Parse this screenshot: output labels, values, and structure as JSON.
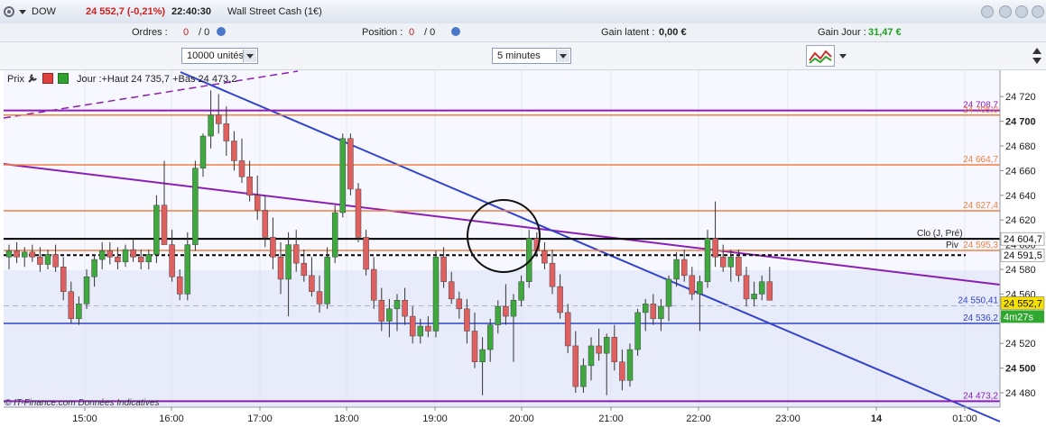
{
  "header": {
    "symbol": "DOW",
    "price": "24 552,7 (-0,21%)",
    "time": "22:40:30",
    "instrument": "Wall Street Cash (1€)"
  },
  "toolbar": {
    "orders_label": "Ordres :",
    "orders_value": "0",
    "orders_sep": "/ 0",
    "position_label": "Position :",
    "position_value": "0",
    "position_sep": "/ 0",
    "latent_label": "Gain latent :",
    "latent_value": "0,00 €",
    "day_label": "Gain Jour :",
    "day_value": "31,47 €"
  },
  "controls": {
    "units": "10000 unités",
    "period": "5 minutes"
  },
  "legend": {
    "prix": "Prix",
    "jour": "Jour :+Haut 24 735,7 +Bas 24 473,2"
  },
  "footer": "© IT-Finance.com  Données Indicatives",
  "colors": {
    "up": "#3fa83f",
    "down": "#e06060",
    "orange": "#f08040",
    "purple": "#8a1fb5",
    "blue": "#3344cc",
    "bg": "#eef0fb"
  },
  "chart_data": {
    "type": "candlestick",
    "y_axis": {
      "min": 24470,
      "max": 24730,
      "ticks": [
        24480,
        24500,
        24520,
        24540,
        24560,
        24580,
        24600,
        24620,
        24640,
        24660,
        24680,
        24700,
        24720
      ]
    },
    "x_ticks": [
      "15:00",
      "16:00",
      "17:00",
      "18:00",
      "19:00",
      "20:00",
      "21:00",
      "22:00",
      "23:00",
      "14",
      "01:00"
    ],
    "levels": [
      {
        "value": 24708.7,
        "label": "24 708,7",
        "color": "#8a1fb5"
      },
      {
        "value": 24705.0,
        "label": "24 705,0",
        "color": "#f08040"
      },
      {
        "value": 24664.7,
        "label": "24 664,7",
        "color": "#f08040"
      },
      {
        "value": 24627.4,
        "label": "24 627,4",
        "color": "#f08040"
      },
      {
        "value": 24604.7,
        "label": "24 604,7",
        "color": "#000000",
        "note": "Clo (J, Pré)"
      },
      {
        "value": 24595.3,
        "label": "24 595,3",
        "color": "#f08040",
        "note": "Piv"
      },
      {
        "value": 24591.5,
        "label": "24 591,5",
        "color": "#000000",
        "dashed": true
      },
      {
        "value": 24550.4,
        "label": "24 550,41",
        "color": "#3344cc"
      },
      {
        "value": 24536.2,
        "label": "24 536,2",
        "color": "#3344cc"
      },
      {
        "value": 24473.2,
        "label": "24 473,2",
        "color": "#8a1fb5"
      }
    ],
    "current": {
      "value": 24552.7,
      "label": "24 552,7",
      "countdown": "4m27s"
    },
    "candles": [
      [
        24590,
        24600,
        24580,
        24595
      ],
      [
        24595,
        24602,
        24585,
        24590
      ],
      [
        24590,
        24598,
        24582,
        24594
      ],
      [
        24594,
        24600,
        24586,
        24590
      ],
      [
        24590,
        24598,
        24578,
        24584
      ],
      [
        24584,
        24596,
        24580,
        24592
      ],
      [
        24592,
        24600,
        24578,
        24582
      ],
      [
        24582,
        24590,
        24555,
        24562
      ],
      [
        24562,
        24570,
        24536,
        24540
      ],
      [
        24540,
        24558,
        24535,
        24552
      ],
      [
        24552,
        24580,
        24548,
        24574
      ],
      [
        24574,
        24592,
        24566,
        24588
      ],
      [
        24588,
        24602,
        24580,
        24595
      ],
      [
        24595,
        24602,
        24584,
        24590
      ],
      [
        24590,
        24598,
        24580,
        24586
      ],
      [
        24586,
        24600,
        24582,
        24596
      ],
      [
        24596,
        24604,
        24586,
        24590
      ],
      [
        24590,
        24596,
        24580,
        24586
      ],
      [
        24586,
        24596,
        24580,
        24592
      ],
      [
        24592,
        24640,
        24585,
        24632
      ],
      [
        24632,
        24668,
        24625,
        24600
      ],
      [
        24600,
        24612,
        24570,
        24574
      ],
      [
        24574,
        24580,
        24555,
        24560
      ],
      [
        24560,
        24610,
        24555,
        24600
      ],
      [
        24600,
        24668,
        24595,
        24662
      ],
      [
        24662,
        24690,
        24655,
        24688
      ],
      [
        24688,
        24725,
        24678,
        24705
      ],
      [
        24705,
        24722,
        24690,
        24698
      ],
      [
        24698,
        24712,
        24672,
        24684
      ],
      [
        24684,
        24692,
        24660,
        24668
      ],
      [
        24668,
        24686,
        24650,
        24655
      ],
      [
        24655,
        24668,
        24635,
        24640
      ],
      [
        24640,
        24656,
        24620,
        24628
      ],
      [
        24628,
        24640,
        24598,
        24606
      ],
      [
        24606,
        24622,
        24580,
        24590
      ],
      [
        24590,
        24602,
        24560,
        24572
      ],
      [
        24572,
        24610,
        24542,
        24600
      ],
      [
        24600,
        24612,
        24578,
        24585
      ],
      [
        24585,
        24596,
        24570,
        24575
      ],
      [
        24575,
        24590,
        24558,
        24562
      ],
      [
        24562,
        24575,
        24545,
        24552
      ],
      [
        24552,
        24598,
        24548,
        24590
      ],
      [
        24590,
        24632,
        24585,
        24626
      ],
      [
        24626,
        24690,
        24622,
        24686
      ],
      [
        24686,
        24690,
        24640,
        24645
      ],
      [
        24645,
        24650,
        24602,
        24606
      ],
      [
        24606,
        24612,
        24575,
        24580
      ],
      [
        24580,
        24590,
        24548,
        24555
      ],
      [
        24555,
        24565,
        24530,
        24538
      ],
      [
        24538,
        24556,
        24525,
        24548
      ],
      [
        24548,
        24560,
        24530,
        24555
      ],
      [
        24555,
        24565,
        24535,
        24542
      ],
      [
        24542,
        24550,
        24520,
        24526
      ],
      [
        24526,
        24540,
        24520,
        24534
      ],
      [
        24534,
        24542,
        24525,
        24530
      ],
      [
        24530,
        24595,
        24525,
        24590
      ],
      [
        24590,
        24598,
        24565,
        24570
      ],
      [
        24570,
        24578,
        24552,
        24556
      ],
      [
        24556,
        24562,
        24540,
        24548
      ],
      [
        24548,
        24556,
        24520,
        24530
      ],
      [
        24530,
        24545,
        24500,
        24505
      ],
      [
        24505,
        24525,
        24478,
        24515
      ],
      [
        24515,
        24540,
        24505,
        24535
      ],
      [
        24535,
        24555,
        24528,
        24550
      ],
      [
        24550,
        24568,
        24535,
        24542
      ],
      [
        24542,
        24560,
        24505,
        24555
      ],
      [
        24555,
        24575,
        24550,
        24570
      ],
      [
        24570,
        24612,
        24565,
        24605
      ],
      [
        24605,
        24610,
        24590,
        24595
      ],
      [
        24595,
        24602,
        24580,
        24585
      ],
      [
        24585,
        24596,
        24560,
        24566
      ],
      [
        24566,
        24576,
        24540,
        24545
      ],
      [
        24545,
        24552,
        24512,
        24518
      ],
      [
        24518,
        24530,
        24480,
        24485
      ],
      [
        24485,
        24508,
        24480,
        24502
      ],
      [
        24502,
        24525,
        24490,
        24518
      ],
      [
        24518,
        24532,
        24506,
        24512
      ],
      [
        24512,
        24528,
        24478,
        24525
      ],
      [
        24525,
        24535,
        24498,
        24505
      ],
      [
        24505,
        24515,
        24482,
        24490
      ],
      [
        24490,
        24520,
        24485,
        24515
      ],
      [
        24515,
        24548,
        24510,
        24545
      ],
      [
        24545,
        24556,
        24530,
        24552
      ],
      [
        24552,
        24560,
        24535,
        24540
      ],
      [
        24540,
        24556,
        24530,
        24550
      ],
      [
        24550,
        24575,
        24538,
        24572
      ],
      [
        24572,
        24594,
        24566,
        24588
      ],
      [
        24588,
        24596,
        24570,
        24575
      ],
      [
        24575,
        24582,
        24555,
        24560
      ],
      [
        24560,
        24575,
        24530,
        24570
      ],
      [
        24570,
        24612,
        24565,
        24605
      ],
      [
        24605,
        24635,
        24582,
        24590
      ],
      [
        24590,
        24600,
        24578,
        24582
      ],
      [
        24582,
        24596,
        24570,
        24590
      ],
      [
        24590,
        24596,
        24570,
        24575
      ],
      [
        24575,
        24582,
        24550,
        24556
      ],
      [
        24556,
        24570,
        24550,
        24560
      ],
      [
        24560,
        24575,
        24555,
        24570
      ],
      [
        24570,
        24582,
        24560,
        24555
      ]
    ]
  }
}
